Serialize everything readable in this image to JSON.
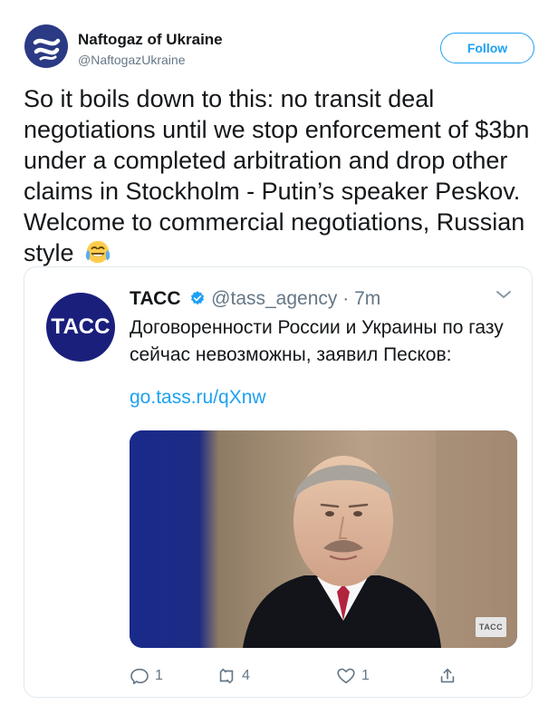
{
  "author": {
    "name": "Naftogaz of Ukraine",
    "handle": "@NaftogazUkraine",
    "follow_label": "Follow"
  },
  "tweet": {
    "text": "So it boils down to this: no transit deal negotiations until we stop enforcement of $3bn under a completed arbitration and drop other claims in Stockholm - Putin’s speaker Peskov. Welcome to commercial negotiations, Russian style",
    "emoji": "face-with-tears-of-joy-icon"
  },
  "quote": {
    "avatar_text": "ТАСС",
    "name": "ТАСС",
    "handle": "@tass_agency",
    "dot": "·",
    "time": "7m",
    "text": "Договоренности России и Украины по газу сейчас невозможны, заявил Песков:",
    "link": "go.tass.ru/qXnw",
    "media_badge": "ТАСС",
    "actions": {
      "reply_count": "1",
      "retweet_count": "4",
      "like_count": "1"
    }
  },
  "colors": {
    "accent": "#1da1f2",
    "text": "#14171a",
    "muted": "#657786",
    "tass_blue": "#1a1f7c"
  }
}
